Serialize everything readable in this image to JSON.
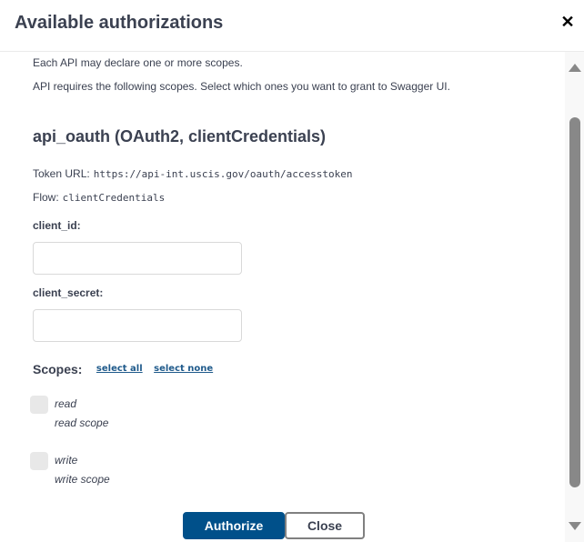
{
  "modal": {
    "title": "Available authorizations",
    "close_icon": "close-icon",
    "close_glyph": "✕"
  },
  "intro": {
    "line1": "Each API may declare one or more scopes.",
    "line2": "API requires the following scopes. Select which ones you want to grant to Swagger UI."
  },
  "auth": {
    "title": "api_oauth (OAuth2, clientCredentials)",
    "token_url_label": "Token URL:",
    "token_url": "https://api-int.uscis.gov/oauth/accesstoken",
    "flow_label": "Flow:",
    "flow": "clientCredentials",
    "client_id_label": "client_id:",
    "client_id_value": "",
    "client_secret_label": "client_secret:",
    "client_secret_value": "",
    "scopes_label": "Scopes:",
    "select_all": "select all",
    "select_none": "select none",
    "scopes": [
      {
        "name": "read",
        "description": "read scope",
        "checked": false
      },
      {
        "name": "write",
        "description": "write scope",
        "checked": false
      }
    ]
  },
  "buttons": {
    "authorize": "Authorize",
    "close": "Close"
  },
  "colors": {
    "primary": "#00508a",
    "link": "#1f5a8b",
    "text": "#3b4151"
  }
}
